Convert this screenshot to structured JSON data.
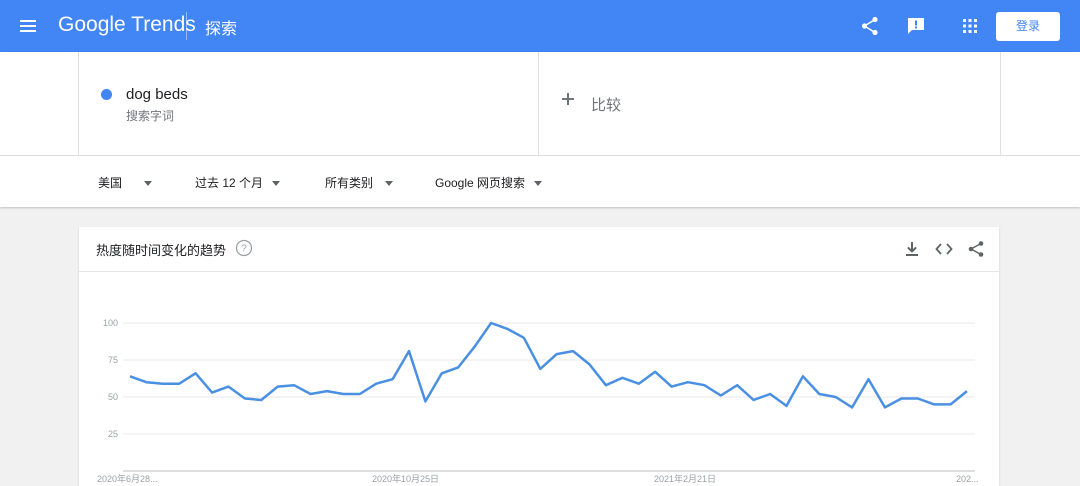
{
  "header": {
    "logo_text": "Google Trends",
    "section": "探索",
    "login_label": "登录",
    "icons": [
      "menu-icon",
      "share-icon",
      "feedback-icon",
      "apps-icon"
    ],
    "color": "#4285f4"
  },
  "search_term": {
    "name": "dog beds",
    "type": "搜索字词",
    "color": "#4285f4"
  },
  "compare": {
    "label": "比较"
  },
  "filters": {
    "region": "美国",
    "time": "过去 12 个月",
    "category": "所有类别",
    "property": "Google 网页搜索"
  },
  "card": {
    "title": "热度随时间变化的趋势",
    "icons": [
      "help-icon",
      "download-icon",
      "embed-icon",
      "share-icon"
    ]
  },
  "chart_data": {
    "type": "line",
    "y_ticks": [
      "100",
      "75",
      "50",
      "25"
    ],
    "x_ticks": [
      "2020年6月28...",
      "2020年10月25日",
      "2021年2月21日",
      "202..."
    ],
    "ylim": [
      0,
      100
    ],
    "grid": true,
    "line_color": "#4a90e2",
    "series": [
      {
        "values": [
          64,
          60,
          59,
          59,
          66,
          53,
          57,
          49,
          48,
          57,
          58,
          52,
          54,
          52,
          52,
          59,
          62,
          81,
          47,
          66,
          70,
          84,
          100,
          96,
          90,
          69,
          79,
          81,
          72,
          58,
          63,
          59,
          67,
          57,
          60,
          58,
          51,
          58,
          48,
          52,
          44,
          64,
          52,
          50,
          43,
          62,
          43,
          49,
          49,
          45,
          45,
          54
        ]
      }
    ]
  }
}
